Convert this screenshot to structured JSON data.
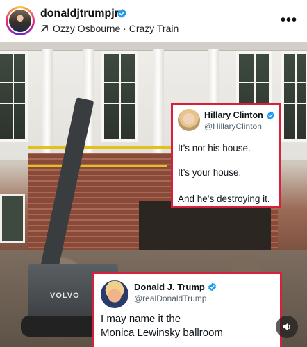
{
  "post": {
    "username": "donaldjtrumpjr",
    "audio_arrow_icon": "arrow-up-right-icon",
    "audio_label": "Ozzy Osbourne · Crazy Train",
    "more_icon": "more-dots-icon"
  },
  "colors": {
    "verified_blue": "#1d9bf0",
    "card_border": "#d5213e"
  },
  "media": {
    "excavator_brand": "VOLVO",
    "sound_icon": "speaker-icon"
  },
  "tweets": {
    "hillary": {
      "name": "Hillary Clinton",
      "handle": "@HillaryClinton",
      "lines": [
        "It’s not his house.",
        "It’s your house.",
        "And he’s destroying it."
      ]
    },
    "trump": {
      "name": "Donald J. Trump",
      "handle": "@realDonaldTrump",
      "lines": [
        "I may name it the",
        "Monica Lewinsky ballroom"
      ]
    }
  }
}
